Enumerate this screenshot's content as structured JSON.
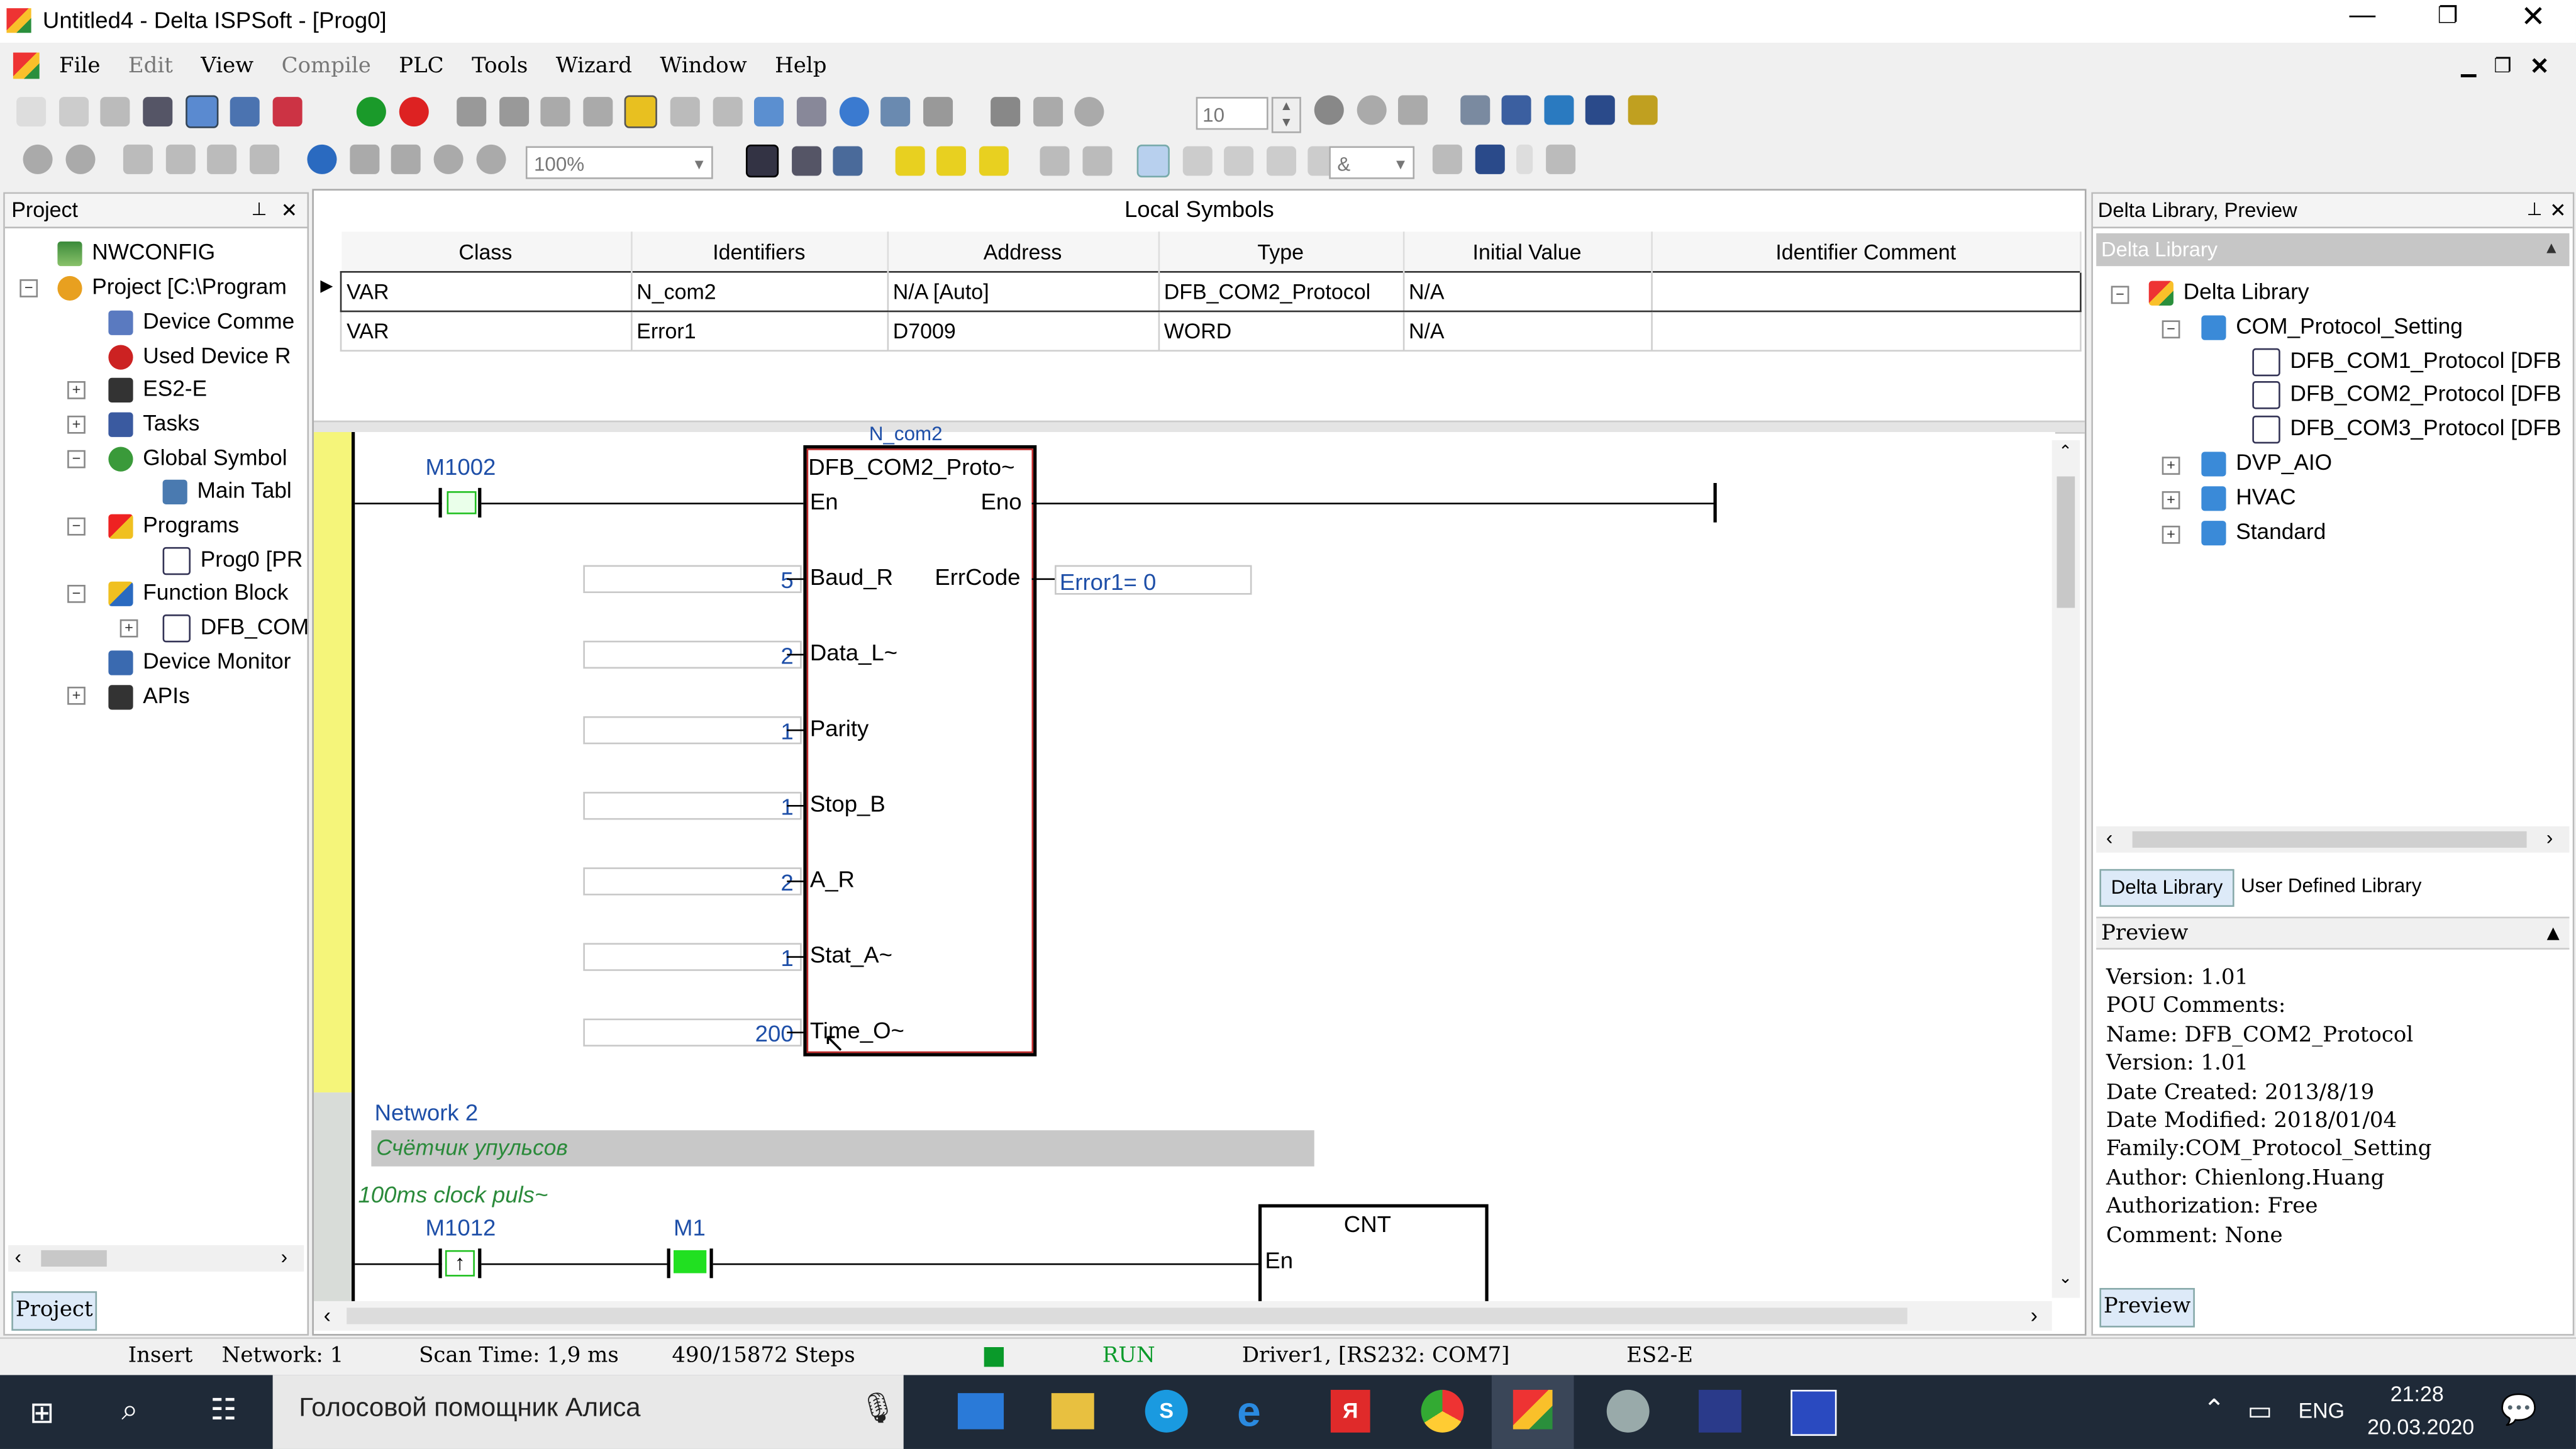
{
  "window": {
    "title": "Untitled4 - Delta ISPSoft - [Prog0]"
  },
  "menu": [
    "File",
    "Edit",
    "View",
    "Compile",
    "PLC",
    "Tools",
    "Wizard",
    "Window",
    "Help"
  ],
  "toolbar": {
    "step_value": "10",
    "zoom_value": "100%",
    "logic_value": "&"
  },
  "project_panel": {
    "title": "Project",
    "tab": "Project",
    "items": [
      {
        "label": "NWCONFIG"
      },
      {
        "label": "Project [C:\\Program"
      },
      {
        "label": "Device Comme"
      },
      {
        "label": "Used Device R"
      },
      {
        "label": "ES2-E"
      },
      {
        "label": "Tasks"
      },
      {
        "label": "Global Symbol"
      },
      {
        "label": "Main Tabl"
      },
      {
        "label": "Programs"
      },
      {
        "label": "Prog0 [PR"
      },
      {
        "label": "Function Block"
      },
      {
        "label": "DFB_COM"
      },
      {
        "label": "Device Monitor"
      },
      {
        "label": "APIs"
      }
    ]
  },
  "local_symbols": {
    "title": "Local Symbols",
    "columns": [
      "Class",
      "Identifiers",
      "Address",
      "Type",
      "Initial Value",
      "Identifier Comment"
    ],
    "rows": [
      [
        "VAR",
        "N_com2",
        "N/A [Auto]",
        "DFB_COM2_Protocol",
        "N/A",
        ""
      ],
      [
        "VAR",
        "Error1",
        "D7009",
        "WORD",
        "N/A",
        ""
      ]
    ]
  },
  "ladder": {
    "instance_label": "N_com2",
    "contact1": "M1002",
    "block_name": "DFB_COM2_Proto~",
    "pins_left": [
      "En",
      "Baud_R",
      "Data_L~",
      "Parity",
      "Stop_B",
      "A_R",
      "Stat_A~",
      "Time_O~"
    ],
    "pins_right": [
      "Eno",
      "ErrCode"
    ],
    "inputs": [
      "5",
      "2",
      "1",
      "1",
      "2",
      "1",
      "200"
    ],
    "errcode_out": "Error1= 0",
    "network2_label": "Network 2",
    "network2_comment": "Счётчик упульсов",
    "rung_comment": "100ms clock puls~",
    "contact2": "M1012",
    "contact3": "M1",
    "cnt_name": "CNT",
    "cnt_pin": "En"
  },
  "library_panel": {
    "title": "Delta Library, Preview",
    "section": "Delta Library",
    "tree": [
      "Delta Library",
      "COM_Protocol_Setting",
      "DFB_COM1_Protocol [DFB",
      "DFB_COM2_Protocol [DFB",
      "DFB_COM3_Protocol [DFB",
      "DVP_AIO",
      "HVAC",
      "Standard"
    ],
    "tabs": [
      "Delta Library",
      "User Defined Library"
    ],
    "preview_title": "Preview",
    "preview_lines": [
      "Version: 1.01",
      "POU Comments:",
      "Name: DFB_COM2_Protocol",
      "Version: 1.01",
      "Date Created:    2013/8/19",
      "Date Modified: 2018/01/04",
      "Family:COM_Protocol_Setting",
      "Author: Chienlong.Huang",
      "Authorization: Free",
      "Comment: None"
    ],
    "preview_tab": "Preview"
  },
  "status": {
    "mode": "Insert",
    "network": "Network: 1",
    "scan": "Scan Time: 1,9 ms",
    "steps": "490/15872 Steps",
    "run": "RUN",
    "driver": "Driver1, [RS232: COM7]",
    "device": "ES2-E"
  },
  "taskbar": {
    "search": "Голосовой помощник Алиса",
    "lang": "ENG",
    "time": "21:28",
    "date": "20.03.2020"
  },
  "colors": {
    "run_green": "#0a9a2a",
    "contact_on": "#21e021",
    "rail_yellow": "#f5f57a",
    "taskbar": "#1f2a38"
  }
}
